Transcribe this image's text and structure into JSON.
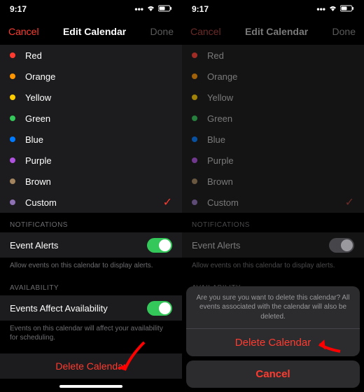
{
  "status": {
    "time": "9:17"
  },
  "nav": {
    "cancel": "Cancel",
    "title": "Edit Calendar",
    "done": "Done"
  },
  "colors": [
    {
      "label": "Red",
      "hex": "#ff3b30",
      "selected": false
    },
    {
      "label": "Orange",
      "hex": "#ff9500",
      "selected": false
    },
    {
      "label": "Yellow",
      "hex": "#ffcc00",
      "selected": false
    },
    {
      "label": "Green",
      "hex": "#34c759",
      "selected": false
    },
    {
      "label": "Blue",
      "hex": "#007aff",
      "selected": false
    },
    {
      "label": "Purple",
      "hex": "#af52de",
      "selected": false
    },
    {
      "label": "Brown",
      "hex": "#a2845e",
      "selected": false
    },
    {
      "label": "Custom",
      "hex": "#8e70b5",
      "selected": true
    }
  ],
  "sections": {
    "notifications": {
      "header": "NOTIFICATIONS",
      "event_alerts": "Event Alerts",
      "desc": "Allow events on this calendar to display alerts."
    },
    "availability": {
      "header": "AVAILABILITY",
      "events_affect": "Events Affect Availability",
      "desc": "Events on this calendar will affect your availability for scheduling."
    }
  },
  "delete": "Delete Calendar",
  "sheet": {
    "message": "Are you sure you want to delete this calendar? All events associated with the calendar will also be deleted.",
    "destructive": "Delete Calendar",
    "cancel": "Cancel"
  },
  "check_mark": "✓"
}
